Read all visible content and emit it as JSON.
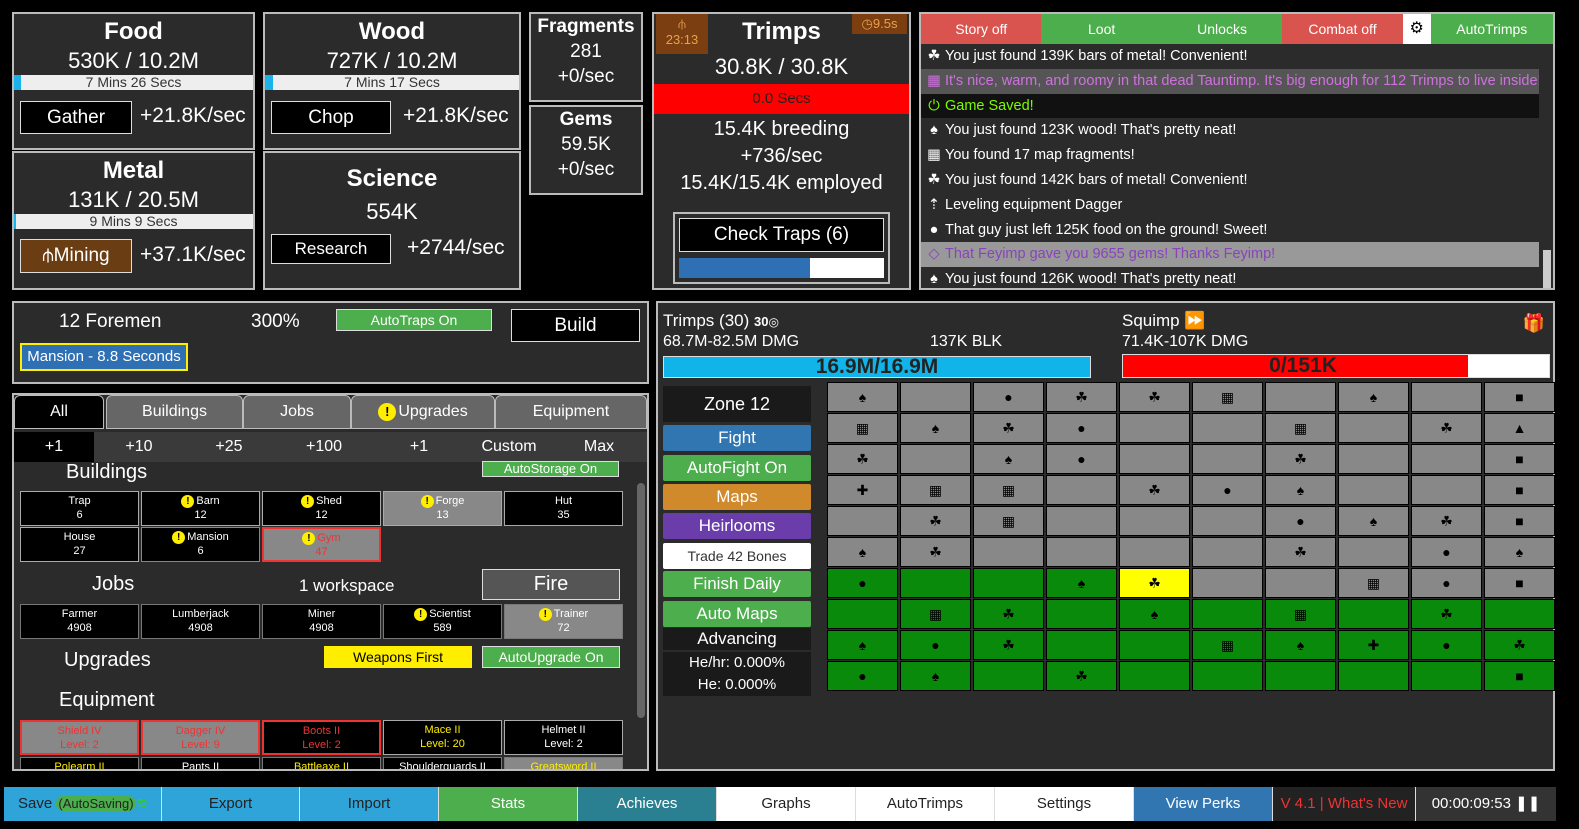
{
  "food": {
    "title": "Food",
    "value": "530K / 10.2M",
    "timer": "7 Mins 26 Secs",
    "fill": 0.03,
    "btn": "Gather",
    "rate": "+21.8K/sec"
  },
  "wood": {
    "title": "Wood",
    "value": "727K / 10.2M",
    "timer": "7 Mins 17 Secs",
    "fill": 0.03,
    "btn": "Chop",
    "rate": "+21.8K/sec"
  },
  "metal": {
    "title": "Metal",
    "value": "131K / 20.5M",
    "timer": "9 Mins 9 Secs",
    "fill": 0.01,
    "btn": "Mining",
    "rate": "+37.1K/sec"
  },
  "science": {
    "title": "Science",
    "value": "554K",
    "btn": "Research",
    "rate": "+2744/sec"
  },
  "fragments": {
    "title": "Fragments",
    "value": "281",
    "rate": "+0/sec"
  },
  "gems": {
    "title": "Gems",
    "value": "59.5K",
    "rate": "+0/sec"
  },
  "trimps": {
    "title": "Trimps",
    "value": "30.8K / 30.8K",
    "timer_left": "23:13",
    "timer_right": "9.5s",
    "bar_text": "0.0 Secs",
    "breeding": "15.4K breeding",
    "rate": "+736/sec",
    "employed": "15.4K/15.4K employed",
    "traps_btn": "Check Traps (6)",
    "trap_fill": 0.64
  },
  "log": {
    "tabs": [
      "Story off",
      "Loot",
      "Unlocks",
      "Combat off",
      "AutoTrimps"
    ],
    "lines": [
      {
        "icon": "☘",
        "text": "You just found 139K bars of metal! Convenient!",
        "color": "#fff",
        "bg": ""
      },
      {
        "icon": "▦",
        "text": "It's nice, warm, and roomy in that dead Tauntimp. It's big enough for 112 Trimps to live inside!",
        "color": "#d070e0",
        "bg": "#555"
      },
      {
        "icon": "⏻",
        "text": "Game Saved!",
        "color": "#7cfc00",
        "bg": "#111"
      },
      {
        "icon": "♠",
        "text": "You just found 123K wood! That's pretty neat!",
        "color": "#fff",
        "bg": ""
      },
      {
        "icon": "▦",
        "text": "You found 17 map fragments!",
        "color": "#fff",
        "bg": ""
      },
      {
        "icon": "☘",
        "text": "You just found 142K bars of metal! Convenient!",
        "color": "#fff",
        "bg": ""
      },
      {
        "icon": "⇡",
        "text": "Leveling equipment Dagger",
        "color": "#fff",
        "bg": ""
      },
      {
        "icon": "●",
        "text": "That guy just left 125K food on the ground! Sweet!",
        "color": "#fff",
        "bg": ""
      },
      {
        "icon": "◇",
        "text": "That Feyimp gave you 9655 gems! Thanks Feyimp!",
        "color": "#8844bb",
        "bg": "#999"
      },
      {
        "icon": "♠",
        "text": "You just found 126K wood! That's pretty neat!",
        "color": "#fff",
        "bg": ""
      }
    ]
  },
  "foremen": {
    "count": "12 Foremen",
    "pct": "300%",
    "autotraps": "AutoTraps On",
    "build": "Build",
    "queue": "Mansion - 8.8 Seconds"
  },
  "tabs": {
    "items": [
      "All",
      "Buildings",
      "Jobs",
      "Upgrades",
      "Equipment"
    ],
    "amounts": [
      "+1",
      "+10",
      "+25",
      "+100",
      "+1",
      "Custom",
      "Max"
    ]
  },
  "buildings": {
    "heading": "Buildings",
    "autostorage": "AutoStorage On",
    "items": [
      {
        "n": "Trap",
        "l": "6"
      },
      {
        "n": "Barn",
        "l": "12"
      },
      {
        "n": "Shed",
        "l": "12"
      },
      {
        "n": "Forge",
        "l": "13"
      },
      {
        "n": "Hut",
        "l": "35"
      },
      {
        "n": "House",
        "l": "27"
      },
      {
        "n": "Mansion",
        "l": "6"
      },
      {
        "n": "Gym",
        "l": "47"
      }
    ]
  },
  "jobs": {
    "heading": "Jobs",
    "workspace": "1 workspace",
    "fire": "Fire",
    "items": [
      {
        "n": "Farmer",
        "l": "4908"
      },
      {
        "n": "Lumberjack",
        "l": "4908"
      },
      {
        "n": "Miner",
        "l": "4908"
      },
      {
        "n": "Scientist",
        "l": "589"
      },
      {
        "n": "Trainer",
        "l": "72"
      }
    ]
  },
  "upgrades": {
    "heading": "Upgrades",
    "weapons": "Weapons First",
    "autoupgrade": "AutoUpgrade On"
  },
  "equipment": {
    "heading": "Equipment",
    "items": [
      {
        "n": "Shield IV",
        "l": "Level: 2"
      },
      {
        "n": "Dagger IV",
        "l": "Level: 9"
      },
      {
        "n": "Boots II",
        "l": "Level: 2"
      },
      {
        "n": "Mace II",
        "l": "Level: 20"
      },
      {
        "n": "Helmet II",
        "l": "Level: 2"
      }
    ],
    "row2": [
      "Polearm II",
      "Pants II",
      "Battleaxe II",
      "Shoulderguards II",
      "Greatsword II"
    ]
  },
  "battle": {
    "trimps_label": "Trimps (30)",
    "trimps_extra": "30",
    "trimps_dmg": "68.7M-82.5M DMG",
    "trimps_blk": "137K BLK",
    "trimps_hp": "16.9M/16.9M",
    "enemy_name": "Squimp",
    "enemy_dmg": "71.4K-107K DMG",
    "enemy_hp": "0/151K",
    "enemy_fill": 0.81
  },
  "map_controls": {
    "zone": "Zone 12",
    "fight": "Fight",
    "autofight": "AutoFight On",
    "maps": "Maps",
    "heirlooms": "Heirlooms",
    "trade": "Trade 42 Bones",
    "finish": "Finish Daily",
    "automaps": "Auto Maps",
    "advancing": "Advancing",
    "hehr": "He/hr: 0.000%",
    "he": "He: 0.000%"
  },
  "grid": [
    [
      "♠",
      "",
      "●",
      "☘",
      "☘",
      "▦",
      "",
      "♠",
      "",
      "■"
    ],
    [
      "▦",
      "♠",
      "☘",
      "●",
      "",
      "",
      "▦",
      "",
      "☘",
      "▲"
    ],
    [
      "☘",
      "",
      "♠",
      "●",
      "",
      "",
      "☘",
      "",
      "",
      "■"
    ],
    [
      "✚",
      "▦",
      "▦",
      "",
      "☘",
      "●",
      "♠",
      "",
      "",
      "■"
    ],
    [
      "",
      "☘",
      "▦",
      "",
      "",
      "",
      "●",
      "♠",
      "☘",
      "■"
    ],
    [
      "♠",
      "☘",
      "",
      "",
      "",
      "",
      "☘",
      "",
      "●",
      "♠"
    ],
    [
      "●",
      "",
      "",
      "♠",
      "☘",
      "",
      "",
      "▦",
      "●",
      "■"
    ],
    [
      "",
      "▦",
      "☘",
      "",
      "♠",
      "",
      "▦",
      "",
      "☘",
      ""
    ],
    [
      "♠",
      "●",
      "☘",
      "",
      "",
      "▦",
      "♠",
      "✚",
      "●",
      "☘"
    ],
    [
      "●",
      "♠",
      "",
      "☘",
      "",
      "",
      "",
      "",
      "",
      "■"
    ]
  ],
  "bottom": {
    "save": "Save",
    "autosaving": "(AutoSaving)",
    "export": "Export",
    "import": "Import",
    "stats": "Stats",
    "achieves": "Achieves",
    "graphs": "Graphs",
    "autotrimps": "AutoTrimps",
    "settings": "Settings",
    "perks": "View Perks",
    "version": "V 4.1 | What's New",
    "clock": "00:00:09:53"
  }
}
